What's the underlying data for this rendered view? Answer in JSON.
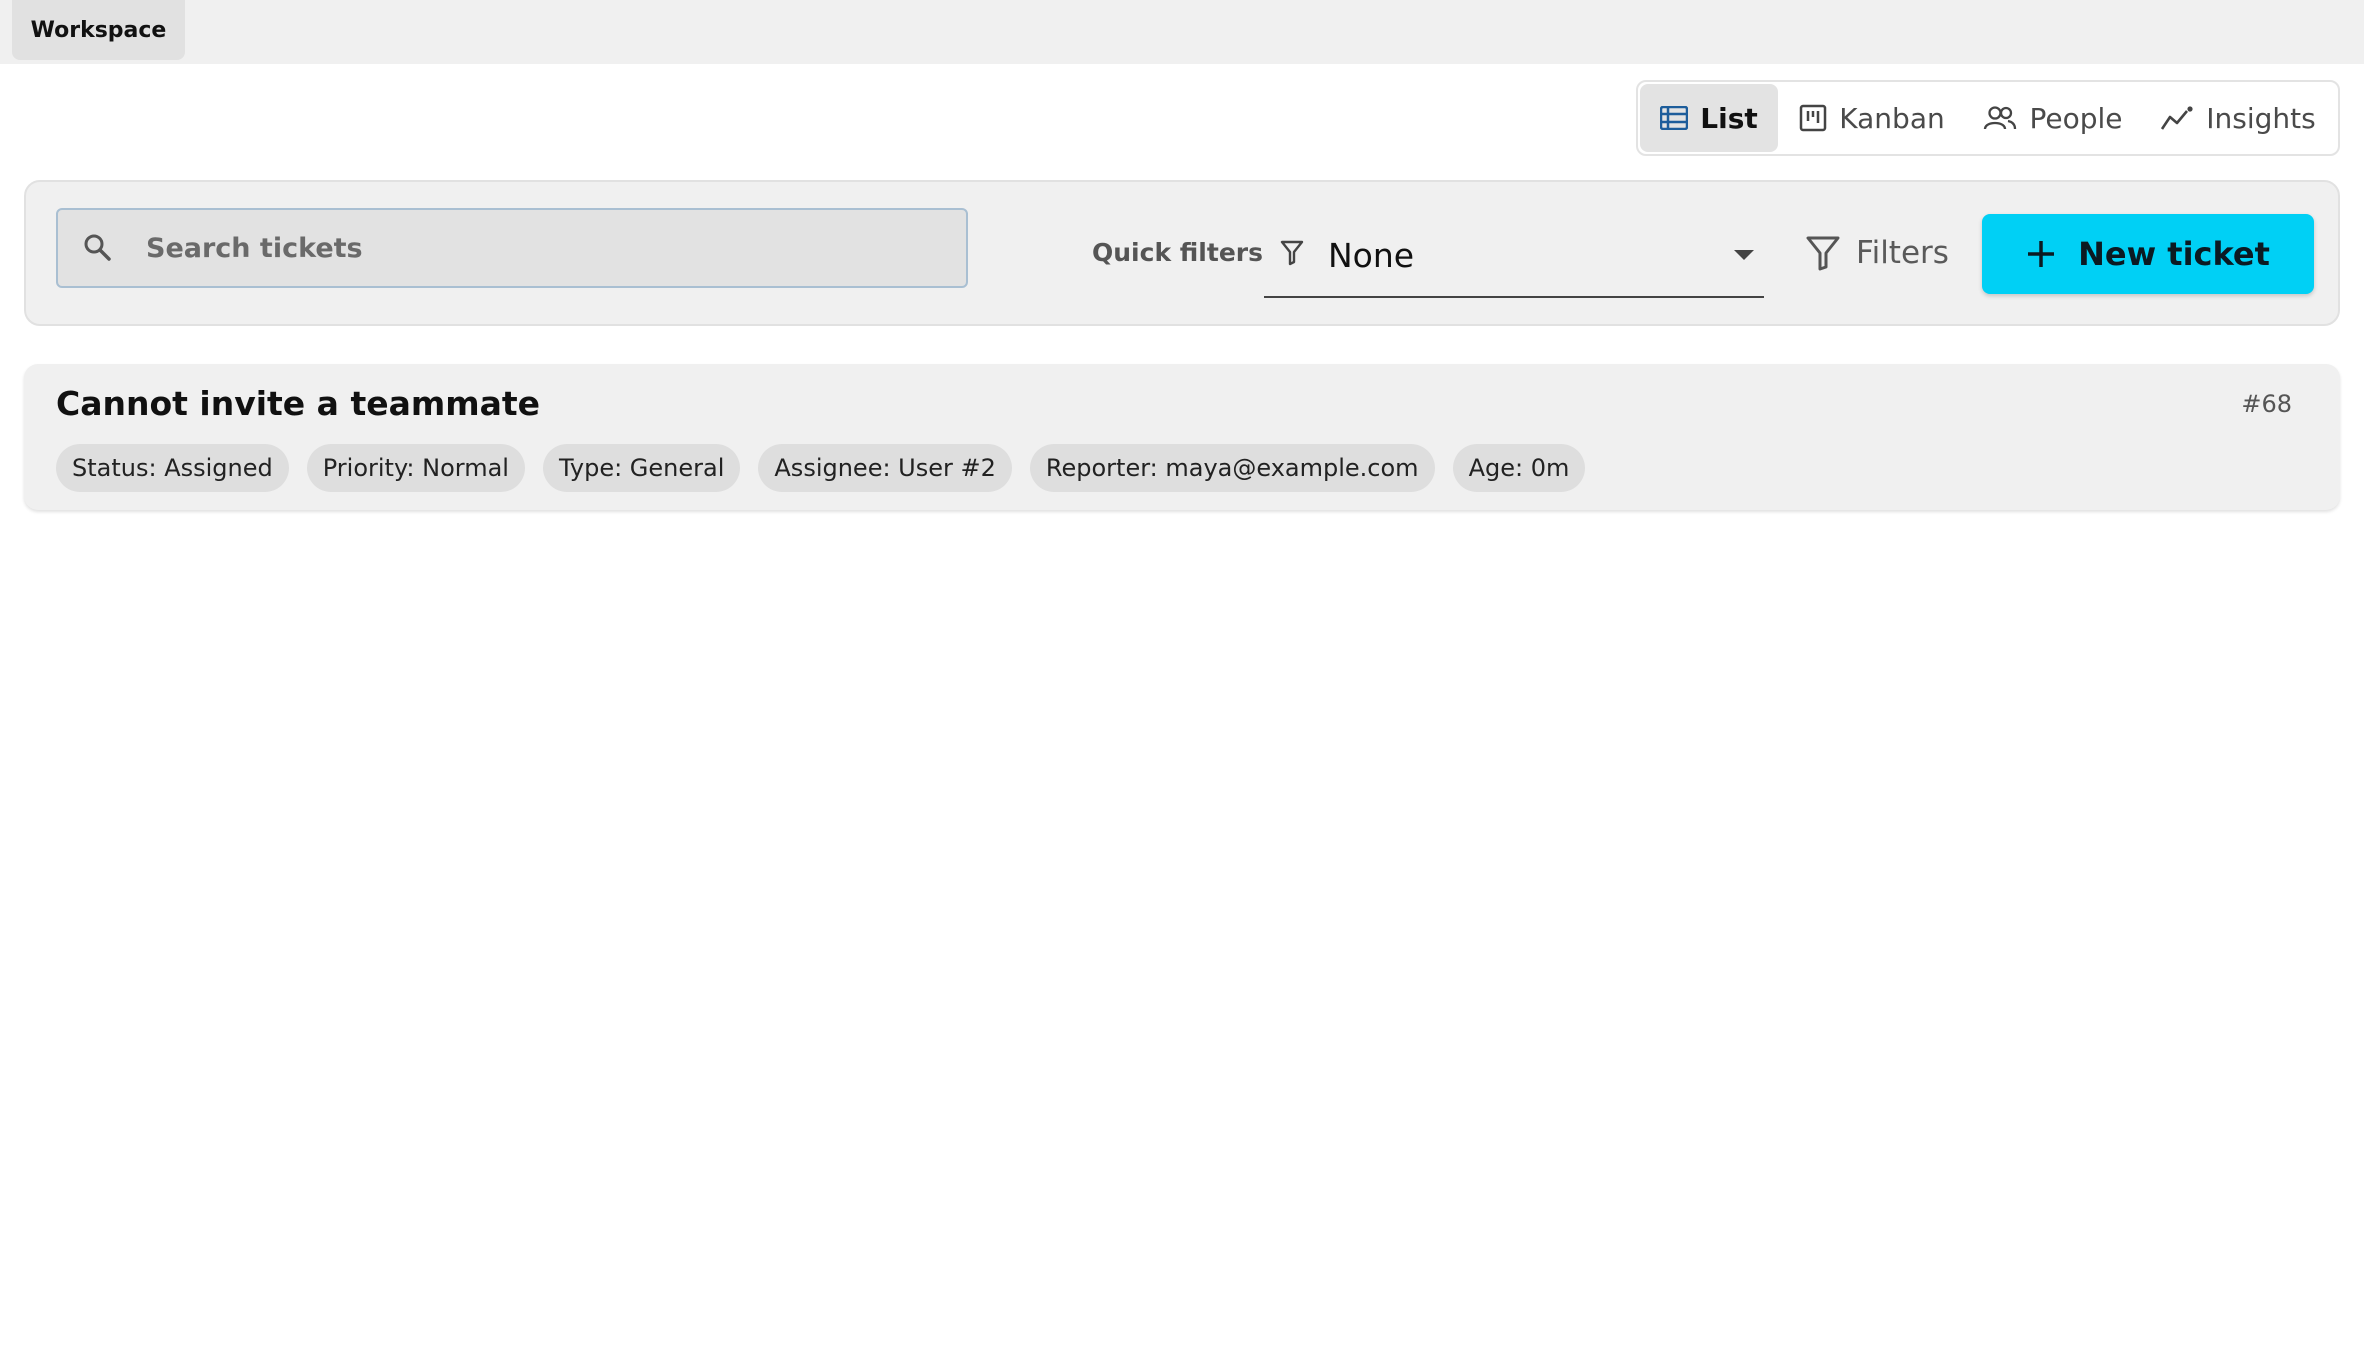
{
  "topbar": {
    "workspace_label": "Workspace"
  },
  "views": [
    {
      "label": "List",
      "icon": "list-icon",
      "active": true
    },
    {
      "label": "Kanban",
      "icon": "kanban-icon",
      "active": false
    },
    {
      "label": "People",
      "icon": "people-icon",
      "active": false
    },
    {
      "label": "Insights",
      "icon": "insights-icon",
      "active": false
    }
  ],
  "toolbar": {
    "search": {
      "placeholder": "Search tickets",
      "value": ""
    },
    "quick_filters": {
      "label": "Quick filters",
      "value": "None"
    },
    "filters_label": "Filters",
    "new_ticket_label": "New ticket",
    "accent_color": "#00d0f5"
  },
  "tickets": [
    {
      "title": "Cannot invite a teammate",
      "id": "#68",
      "chips": [
        "Status: Assigned",
        "Priority: Normal",
        "Type: General",
        "Assignee: User #2",
        "Reporter: maya@example.com",
        "Age: 0m"
      ]
    }
  ]
}
